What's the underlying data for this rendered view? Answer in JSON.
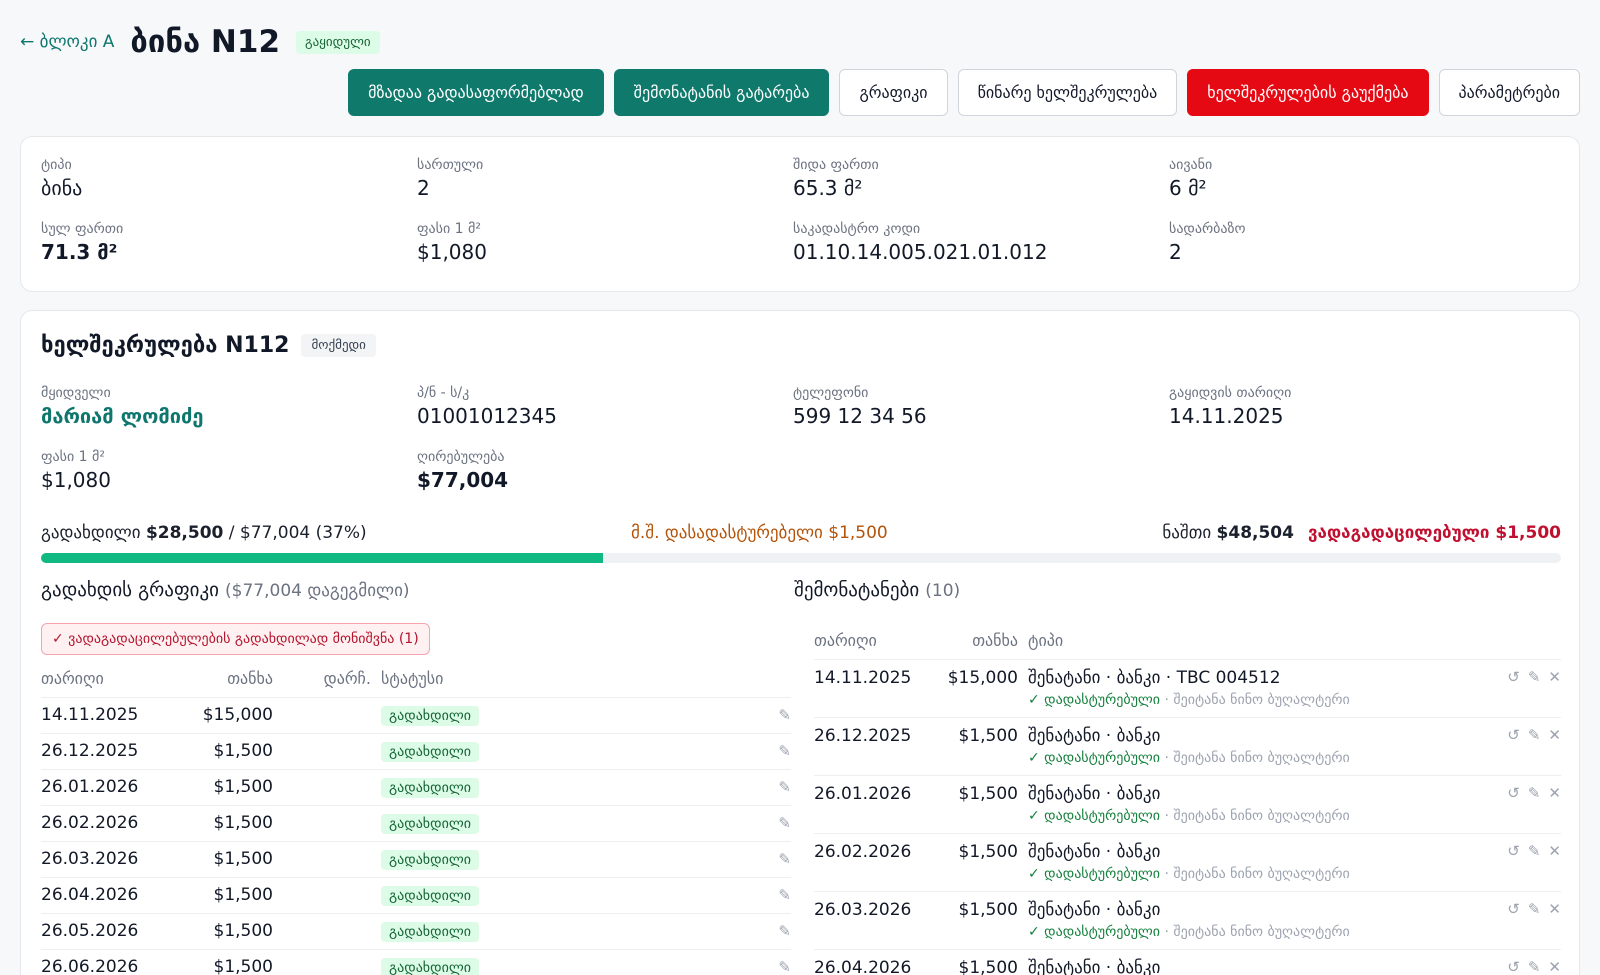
{
  "header": {
    "back_label": "← ბლოკი A",
    "title": "ბინა N12",
    "status": "გაყიდული"
  },
  "actions": [
    {
      "label": "მზადაა გადასაფორმებლად",
      "style": "teal"
    },
    {
      "label": "შემონატანის გატარება",
      "style": "teal"
    },
    {
      "label": "გრაფიკი",
      "style": "default"
    },
    {
      "label": "წინარე ხელშეკრულება",
      "style": "default"
    },
    {
      "label": "ხელშეკრულების გაუქმება",
      "style": "red"
    },
    {
      "label": "პარამეტრები",
      "style": "default"
    }
  ],
  "info": {
    "type_label": "ტიპი",
    "type_value": "ბინა",
    "floor_label": "სართული",
    "floor_value": "2",
    "inner_area_label": "შიდა ფართი",
    "inner_area_value": "65.3 მ²",
    "balcony_label": "აივანი",
    "balcony_value": "6 მ²",
    "total_area_label": "სულ ფართი",
    "total_area_value": "71.3 მ²",
    "price_label": "ფასი 1 მ²",
    "price_value": "$1,080",
    "cadastral_label": "საკადასტრო კოდი",
    "cadastral_value": "01.10.14.005.021.01.012",
    "entrance_label": "სადარბაზო",
    "entrance_value": "2"
  },
  "contract": {
    "title": "ხელშეკრულება N112",
    "status": "მოქმედი",
    "buyer_label": "მყიდველი",
    "buyer_value": "მარიამ ლომიძე",
    "id_label": "პ/ნ - ს/კ",
    "id_value": "01001012345",
    "phone_label": "ტელეფონი",
    "phone_value": "599 12 34 56",
    "sale_date_label": "გაყიდვის თარიღი",
    "sale_date_value": "14.11.2025",
    "price_label": "ფასი 1 მ²",
    "price_value": "$1,080",
    "value_label": "ღირებულება",
    "value_value": "$77,004"
  },
  "summary": {
    "paid_label": "გადახდილი",
    "paid_amount": "$28,500",
    "paid_total": " / $77,004 (37%)",
    "pending": "მ.შ. დასადასტურებელი $1,500",
    "remaining_label": "ნაშთი",
    "remaining_amount": "$48,504",
    "overdue": "ვადაგადაცილებული $1,500",
    "progress_fraction": 0.37
  },
  "schedule": {
    "title": "გადახდის გრაფიკი",
    "planned": "($77,004 დაგეგმილი)",
    "overdue_button": "✓ ვადაგადაცილებულების გადახდილად მონიშვნა (1)",
    "columns": {
      "date": "თარიღი",
      "amount": "თანხა",
      "remaining": "დარჩ.",
      "status": "სტატუსი"
    },
    "rows": [
      {
        "date": "14.11.2025",
        "amount": "$15,000",
        "remaining": "",
        "status": "გადახდილი"
      },
      {
        "date": "26.12.2025",
        "amount": "$1,500",
        "remaining": "",
        "status": "გადახდილი"
      },
      {
        "date": "26.01.2026",
        "amount": "$1,500",
        "remaining": "",
        "status": "გადახდილი"
      },
      {
        "date": "26.02.2026",
        "amount": "$1,500",
        "remaining": "",
        "status": "გადახდილი"
      },
      {
        "date": "26.03.2026",
        "amount": "$1,500",
        "remaining": "",
        "status": "გადახდილი"
      },
      {
        "date": "26.04.2026",
        "amount": "$1,500",
        "remaining": "",
        "status": "გადახდილი"
      },
      {
        "date": "26.05.2026",
        "amount": "$1,500",
        "remaining": "",
        "status": "გადახდილი"
      },
      {
        "date": "26.06.2026",
        "amount": "$1,500",
        "remaining": "",
        "status": "გადახდილი"
      }
    ]
  },
  "income": {
    "title": "შემონატანები",
    "count": "(10)",
    "columns": {
      "date": "თარიღი",
      "amount": "თანხა",
      "type": "ტიპი"
    },
    "rows": [
      {
        "date": "14.11.2025",
        "amount": "$15,000",
        "type": "შენატანი · ბანკი · TBC 004512",
        "confirmed": "✓ დადასტურებული",
        "note": " · შეიტანა ნინო ბუღალტერი"
      },
      {
        "date": "26.12.2025",
        "amount": "$1,500",
        "type": "შენატანი · ბანკი",
        "confirmed": "✓ დადასტურებული",
        "note": " · შეიტანა ნინო ბუღალტერი"
      },
      {
        "date": "26.01.2026",
        "amount": "$1,500",
        "type": "შენატანი · ბანკი",
        "confirmed": "✓ დადასტურებული",
        "note": " · შეიტანა ნინო ბუღალტერი"
      },
      {
        "date": "26.02.2026",
        "amount": "$1,500",
        "type": "შენატანი · ბანკი",
        "confirmed": "✓ დადასტურებული",
        "note": " · შეიტანა ნინო ბუღალტერი"
      },
      {
        "date": "26.03.2026",
        "amount": "$1,500",
        "type": "შენატანი · ბანკი",
        "confirmed": "✓ დადასტურებული",
        "note": " · შეიტანა ნინო ბუღალტერი"
      },
      {
        "date": "26.04.2026",
        "amount": "$1,500",
        "type": "შენატანი · ბანკი",
        "confirmed": "",
        "note": ""
      }
    ],
    "icons": {
      "undo": "↺",
      "edit": "✎",
      "delete": "✕"
    }
  },
  "icons": {
    "edit": "✎"
  }
}
